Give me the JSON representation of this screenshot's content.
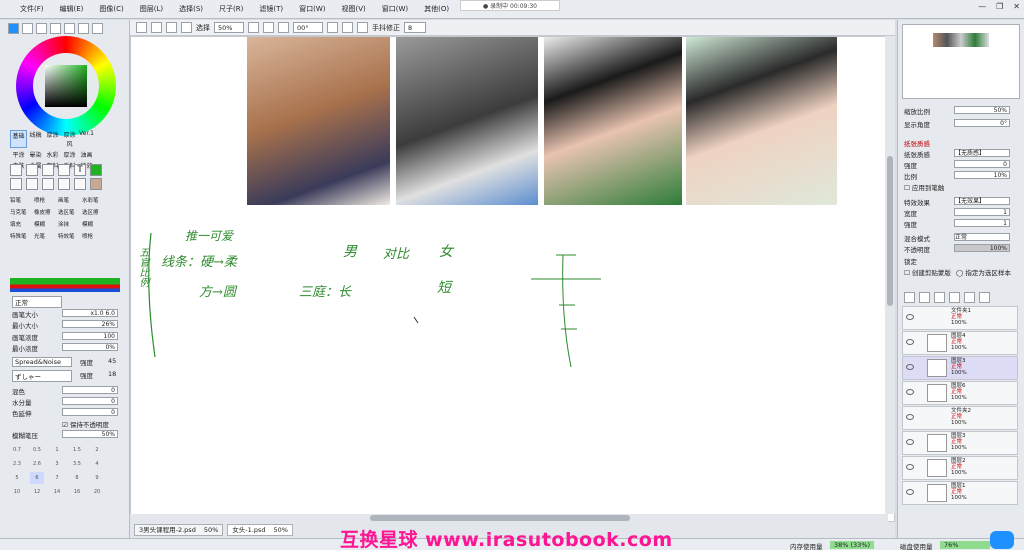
{
  "menu": [
    "文件(F)",
    "编辑(E)",
    "图像(C)",
    "图层(L)",
    "选择(S)",
    "尺子(R)",
    "滤镜(T)",
    "窗口(W)",
    "视图(V)",
    "窗口(W)",
    "其他(O)"
  ],
  "recording": "● 录制中 00:09:30",
  "toolbar": {
    "select_label": "选择",
    "zoom": "50%",
    "angle": "00°",
    "stabilizer_label": "手抖修正",
    "stabilizer_value": "8"
  },
  "left": {
    "tabs": [
      "基础",
      "线稿",
      "厚涂",
      "厚涂风",
      "Ver.1",
      "平涂",
      "晕染",
      "水彩",
      "厚涂",
      "油画",
      "皮肤",
      "金属",
      "布料",
      "毛料",
      "特效"
    ],
    "brushes": [
      [
        "铅笔",
        "喷枪",
        "画笔",
        "水彩笔"
      ],
      [
        "马克笔",
        "橡皮擦",
        "选区笔",
        "选区擦"
      ],
      [
        "填充",
        "模糊",
        "涂抹",
        "模糊"
      ],
      [
        "特殊笔",
        "光笔",
        "特效笔",
        "喷枪"
      ]
    ],
    "blend_mode": "正常",
    "brush_size_label": "画笔大小",
    "brush_size_mult": "x1.0",
    "brush_size": "6.0",
    "min_size_label": "最小大小",
    "min_size": "26%",
    "density_label": "画笔浓度",
    "density": "100",
    "min_density_label": "最小浓度",
    "min_density": "0%",
    "texture": "Spread&Noise",
    "texture_label": "强度",
    "texture_val": "45",
    "texture2": "ずしゃー",
    "texture2_label": "强度",
    "texture2_val": "18",
    "mix_label": "混色",
    "mix": "0",
    "water_label": "水分量",
    "water": "0",
    "color_extend_label": "色延伸",
    "color_extend": "0",
    "keep_opacity": "保持不透明度",
    "blur_label": "模糊笔压",
    "blur": "50%",
    "size_grid": [
      "0.7",
      "0.5",
      "1",
      "1.5",
      "2",
      "2.3",
      "2.6",
      "3",
      "3.5",
      "4",
      "5",
      "6",
      "7",
      "8",
      "9",
      "10",
      "12",
      "14",
      "16",
      "20"
    ]
  },
  "right": {
    "zoom_label": "缩放比例",
    "zoom": "50%",
    "angle_label": "显示角度",
    "angle": "0°",
    "paper_header": "纸张质感",
    "paper_texture_label": "纸张质感",
    "paper_texture": "【无质感】",
    "strength_label": "强度",
    "strength": "0",
    "scale_label": "比例",
    "scale": "10%",
    "apply_brush": "应用到笔触",
    "effect_label": "特效效果",
    "effect": "【无效果】",
    "width_label": "宽度",
    "width": "1",
    "strength2_label": "强度",
    "strength2": "1",
    "blend_label": "混合模式",
    "blend": "正常",
    "opacity_label": "不透明度",
    "opacity": "100%",
    "protect_label": "锁定",
    "clip_label": "创建剪贴蒙版",
    "select_source_label": "指定为选区样本",
    "layers": [
      {
        "name": "文件夹1",
        "mode": "正常",
        "pct": "100%",
        "folder": true
      },
      {
        "name": "图层4",
        "mode": "正常",
        "pct": "100%"
      },
      {
        "name": "图层3",
        "mode": "正常",
        "pct": "100%",
        "sel": true
      },
      {
        "name": "图层6",
        "mode": "正常",
        "pct": "100%"
      },
      {
        "name": "文件夹2",
        "mode": "正常",
        "pct": "100%",
        "folder": true
      },
      {
        "name": "图层3",
        "mode": "正常",
        "pct": "100%"
      },
      {
        "name": "图层2",
        "mode": "正常",
        "pct": "100%"
      },
      {
        "name": "图层1",
        "mode": "正常",
        "pct": "100%"
      }
    ]
  },
  "tabs": [
    {
      "name": "3男头课程用-2.psd",
      "zoom": "50%"
    },
    {
      "name": "女头-1.psd",
      "zoom": "50%"
    }
  ],
  "status": {
    "mem_label": "内存使用量",
    "mem": "38% (33%)",
    "disk_label": "磁盘使用量",
    "disk": "76%"
  },
  "watermark": "互换星球 www.irasutobook.com",
  "canvas_notes": [
    "推一可爱",
    "线条：硬→柔",
    "方→圆",
    "五官比例",
    "男",
    "对比",
    "女",
    "三庭：长",
    "短"
  ],
  "colors": {
    "accent": "#1e90ff",
    "handwriting": "#2e8b2e",
    "watermark": "#ff1493"
  }
}
